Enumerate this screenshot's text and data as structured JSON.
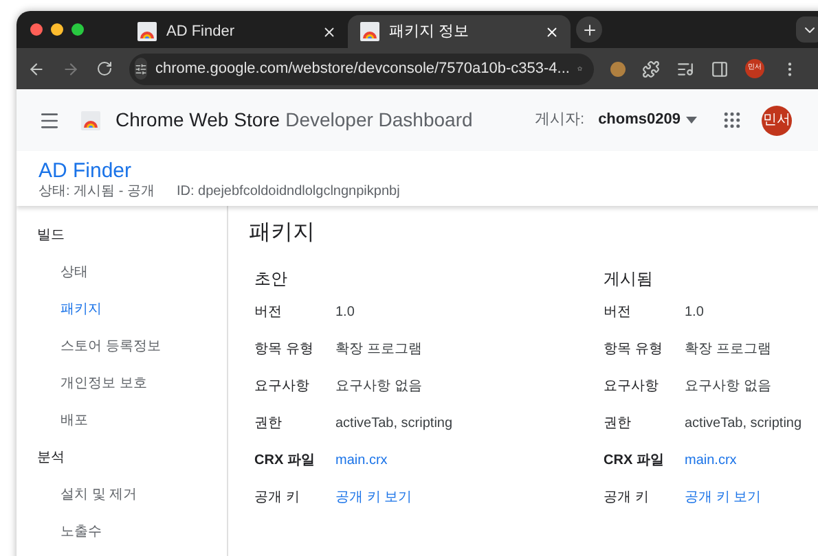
{
  "tabs": [
    {
      "title": "AD Finder",
      "selected": false
    },
    {
      "title": "패키지 정보",
      "selected": true
    }
  ],
  "address": "chrome.google.com/webstore/devconsole/7570a10b-c353-4...",
  "profile_avatar": "민서",
  "header": {
    "brand": "Chrome Web Store",
    "product": "Developer Dashboard",
    "publisher_label": "게시자:",
    "publisher": "choms0209",
    "avatar": "민서"
  },
  "app": {
    "name": "AD Finder",
    "status": "상태: 게시됨 - 공개",
    "id": "ID: dpejebfcoldoidndlolgclngnpikpnbj"
  },
  "sidebar": [
    {
      "label": "빌드",
      "children": [
        {
          "label": "상태",
          "selected": false
        },
        {
          "label": "패키지",
          "selected": true
        },
        {
          "label": "스토어 등록정보",
          "selected": false
        },
        {
          "label": "개인정보 보호",
          "selected": false
        },
        {
          "label": "배포",
          "selected": false
        }
      ]
    },
    {
      "label": "분석",
      "children": [
        {
          "label": "설치 및 제거",
          "selected": false
        },
        {
          "label": "노출수",
          "selected": false
        }
      ]
    }
  ],
  "page_title": "패키지",
  "panels": [
    {
      "title": "초안",
      "rows": [
        {
          "label": "버전",
          "value": "1.0",
          "kind": "text"
        },
        {
          "label": "항목 유형",
          "value": "확장 프로그램",
          "kind": "text"
        },
        {
          "label": "요구사항",
          "value": "요구사항 없음",
          "kind": "text"
        },
        {
          "label": "권한",
          "value": "activeTab, scripting",
          "kind": "text"
        },
        {
          "label": "CRX 파일",
          "value": "main.crx",
          "kind": "link"
        },
        {
          "label": "공개 키",
          "value": "공개 키 보기",
          "kind": "link"
        }
      ]
    },
    {
      "title": "게시됨",
      "rows": [
        {
          "label": "버전",
          "value": "1.0",
          "kind": "text"
        },
        {
          "label": "항목 유형",
          "value": "확장 프로그램",
          "kind": "text"
        },
        {
          "label": "요구사항",
          "value": "요구사항 없음",
          "kind": "text"
        },
        {
          "label": "권한",
          "value": "activeTab, scripting",
          "kind": "text"
        },
        {
          "label": "CRX 파일",
          "value": "main.crx",
          "kind": "link"
        },
        {
          "label": "공개 키",
          "value": "공개 키 보기",
          "kind": "link"
        }
      ]
    }
  ]
}
